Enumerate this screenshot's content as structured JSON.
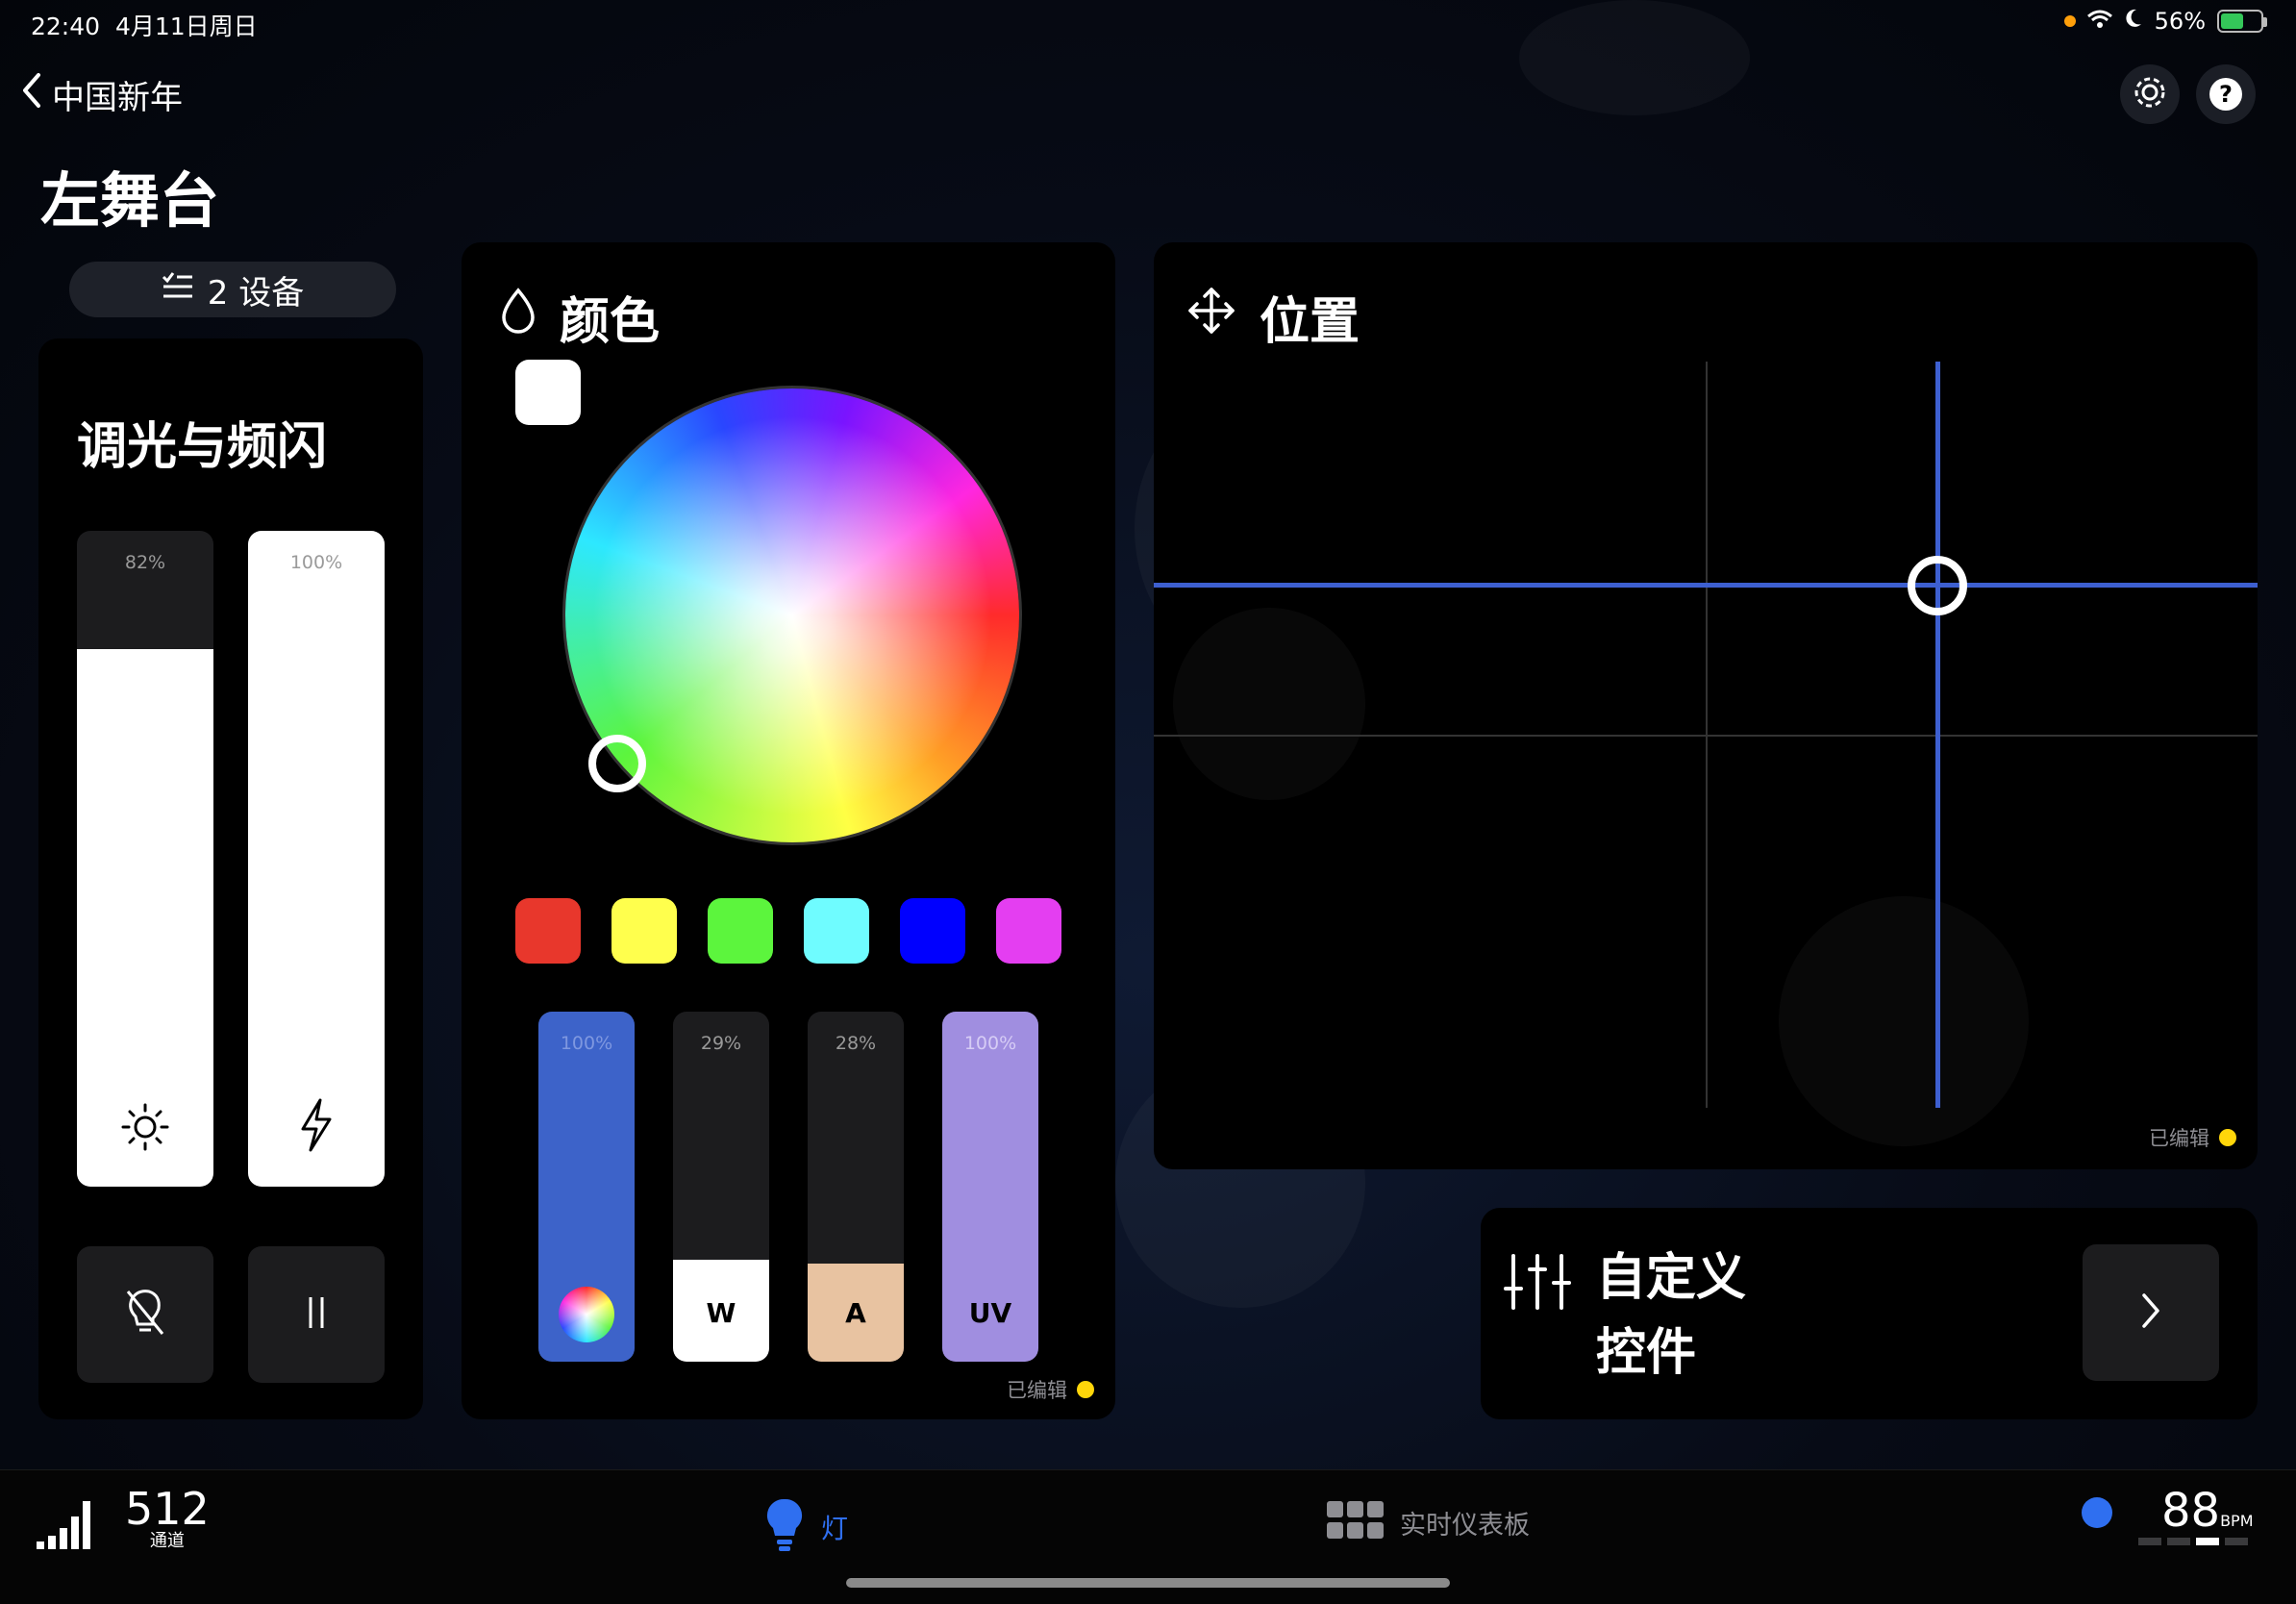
{
  "status": {
    "time": "22:40",
    "date": "4月11日周日",
    "battery": "56%",
    "battery_level": 0.56,
    "icons": [
      "privacy-dot",
      "wifi-icon",
      "moon-icon",
      "battery-charging-icon"
    ]
  },
  "header": {
    "back_label": "中国新年",
    "title": "左舞台",
    "devices_label": "2 设备"
  },
  "dimmer": {
    "title": "调光与频闪",
    "brightness_label": "82%",
    "brightness_value": 0.82,
    "strobe_label": "100%",
    "strobe_value": 1.0
  },
  "color": {
    "title": "颜色",
    "selected_color": "#ffffff",
    "swatches": [
      "#e8372c",
      "#ffff4d",
      "#5cf53d",
      "#6ffcff",
      "#0000ff",
      "#e43ef1"
    ],
    "channels": [
      {
        "key": "rgb",
        "label": "",
        "pct": "100%",
        "value": 1.0,
        "color": "#3d63c9"
      },
      {
        "key": "w",
        "label": "W",
        "pct": "29%",
        "value": 0.29,
        "color": "#ffffff"
      },
      {
        "key": "a",
        "label": "A",
        "pct": "28%",
        "value": 0.28,
        "color": "#e8c3a1"
      },
      {
        "key": "uv",
        "label": "UV",
        "pct": "100%",
        "value": 1.0,
        "color": "#a08ee0"
      }
    ],
    "edited_label": "已编辑"
  },
  "position": {
    "title": "位置",
    "pan": 0.71,
    "tilt": 0.3,
    "edited_label": "已编辑",
    "accent": "#3d5fd0"
  },
  "custom": {
    "title_line1": "自定义",
    "title_line2": "控件"
  },
  "bottom": {
    "channels_value": "512",
    "channels_label": "通道",
    "lights_label": "灯",
    "dashboard_label": "实时仪表板",
    "bpm_value": "88",
    "bpm_unit": "BPM",
    "accent": "#2f6ff0"
  }
}
